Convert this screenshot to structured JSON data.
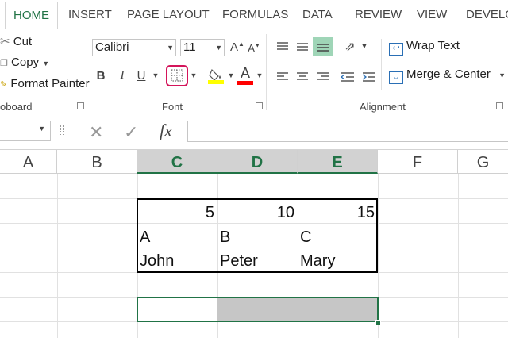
{
  "tabs": [
    "HOME",
    "INSERT",
    "PAGE LAYOUT",
    "FORMULAS",
    "DATA",
    "REVIEW",
    "VIEW",
    "DEVELO"
  ],
  "clipboard": {
    "cut": "Cut",
    "copy": "Copy",
    "format_painter": "Format Painter",
    "group_label": "oboard"
  },
  "font": {
    "family": "Calibri",
    "size": "11",
    "group_label": "Font",
    "bold": "B",
    "italic": "I",
    "underline": "U"
  },
  "alignment": {
    "wrap_text": "Wrap Text",
    "merge_center": "Merge & Center",
    "group_label": "Alignment"
  },
  "formula_bar": {
    "fx": "fx",
    "value": ""
  },
  "columns": [
    "A",
    "B",
    "C",
    "D",
    "E",
    "F",
    "G"
  ],
  "cells": {
    "r1": [
      "5",
      "10",
      "15"
    ],
    "r2": [
      "A",
      "B",
      "C"
    ],
    "r3": [
      "John",
      "Peter",
      "Mary"
    ]
  },
  "colors": {
    "accent": "#217346",
    "highlight_bar": "#ffff00",
    "font_color_bar": "#ff0000",
    "borders_focus": "#d4145a"
  }
}
